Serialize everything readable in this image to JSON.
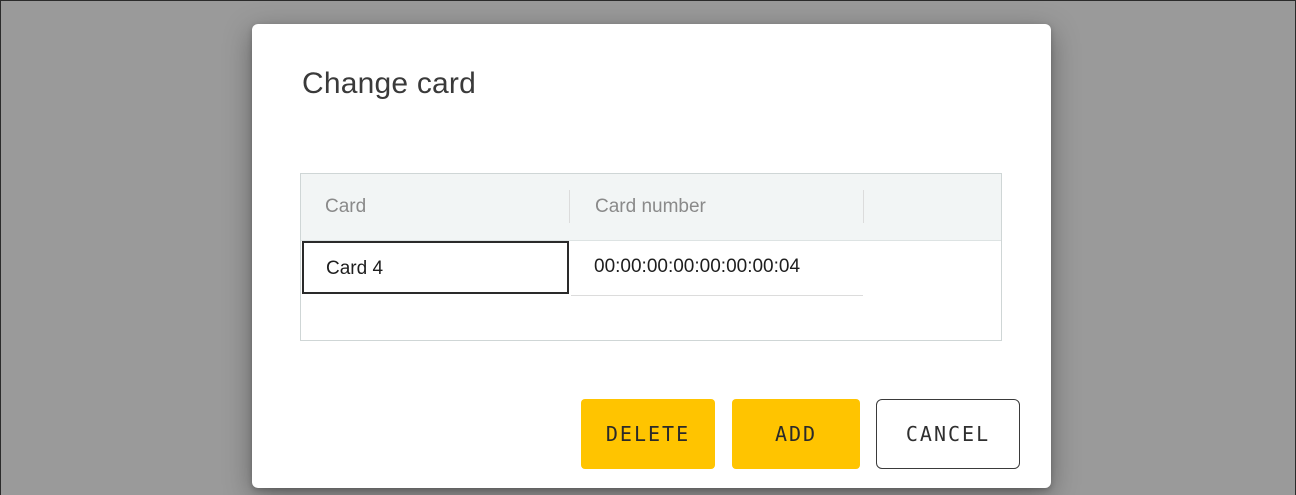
{
  "dialog": {
    "title": "Change card"
  },
  "table": {
    "columns": [
      "Card",
      "Card number",
      ""
    ],
    "rows": [
      {
        "card": "Card 4",
        "card_number": "00:00:00:00:00:00:00:04"
      }
    ]
  },
  "buttons": {
    "delete": "DELETE",
    "add": "ADD",
    "cancel": "CANCEL"
  },
  "colors": {
    "backdrop": "#9a9a9a",
    "primary_button": "#ffc400",
    "header_bg": "#f2f5f5"
  }
}
